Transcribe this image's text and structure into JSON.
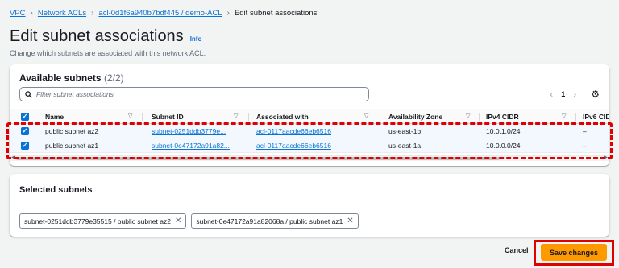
{
  "breadcrumb": {
    "items": [
      "VPC",
      "Network ACLs",
      "acl-0d1f6a940b7bdf445 / demo-ACL"
    ],
    "current": "Edit subnet associations",
    "separator": ">"
  },
  "page": {
    "title": "Edit subnet associations",
    "info": "Info",
    "description": "Change which subnets are associated with this network ACL."
  },
  "available": {
    "title": "Available subnets",
    "count": "(2/2)",
    "filter_placeholder": "Filter subnet associations",
    "page_number": "1",
    "columns": [
      "Name",
      "Subnet ID",
      "Associated with",
      "Availability Zone",
      "IPv4 CIDR",
      "IPv6 CID"
    ],
    "rows": [
      {
        "name": "public subnet az2",
        "subnet_id": "subnet-0251ddb3779e...",
        "associated_with": "acl-0117aacde66eb6516",
        "az": "us-east-1b",
        "ipv4": "10.0.1.0/24",
        "ipv6": "–",
        "checked": true
      },
      {
        "name": "public subnet az1",
        "subnet_id": "subnet-0e47172a91a82...",
        "associated_with": "acl-0117aacde66eb6516",
        "az": "us-east-1a",
        "ipv4": "10.0.0.0/24",
        "ipv6": "–",
        "checked": true
      }
    ]
  },
  "selected": {
    "title": "Selected subnets",
    "tokens": [
      "subnet-0251ddb3779e35515 / public subnet az2",
      "subnet-0e47172a91a82068a / public subnet az1"
    ]
  },
  "footer": {
    "cancel_label": "Cancel",
    "save_label": "Save changes"
  },
  "colors": {
    "primary_button": "#ff9900",
    "link": "#0972d3",
    "highlight": "#e00000"
  }
}
